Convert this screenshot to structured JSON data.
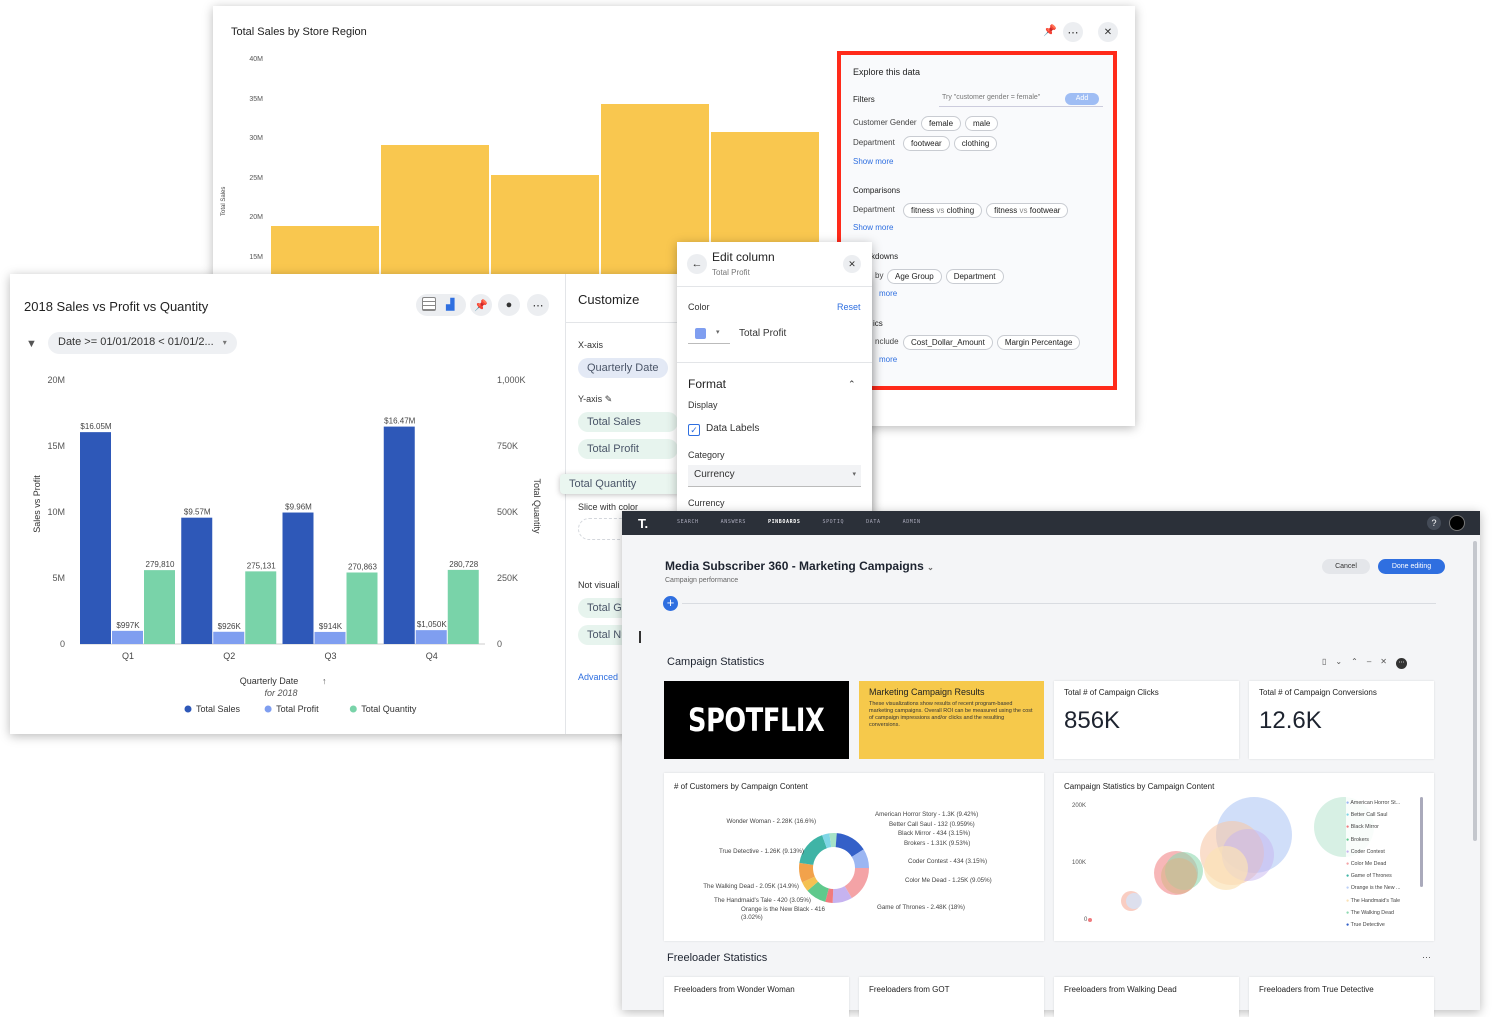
{
  "window_back": {
    "title": "Total Sales by Store Region",
    "y_ticks": [
      "40M",
      "35M",
      "30M",
      "25M",
      "20M",
      "15M"
    ],
    "y_label": "Total Sales",
    "explore": {
      "title": "Explore this data",
      "filters_label": "Filters",
      "filters_placeholder": "Try \"customer gender = female\"",
      "add_label": "Add",
      "gender_label": "Customer Gender",
      "gender_chips": [
        "female",
        "male"
      ],
      "dept_label": "Department",
      "dept_chips": [
        "footwear",
        "clothing"
      ],
      "show_more": "Show more",
      "comparisons_label": "Comparisons",
      "comp_dept_label": "Department",
      "comp_chip_1a": "fitness",
      "comp_chip_1b": "clothing",
      "comp_chip_2a": "fitness",
      "comp_chip_2b": "footwear",
      "vs": "vs",
      "drilldowns_label": "kdowns",
      "drill_by": "by",
      "drill_chips": [
        "Age Group",
        "Department"
      ],
      "more": "more",
      "metrics_label": "ics",
      "include_label": "nclude",
      "metric_chips": [
        "Cost_Dollar_Amount",
        "Margin Percentage"
      ]
    },
    "colors": {
      "bar": "#f9c74f",
      "highlight": "#ff2a1a"
    }
  },
  "window_mid": {
    "title": "2018 Sales vs Profit vs Quantity",
    "filter": "Date >= 01/01/2018 < 01/01/2...",
    "customize": {
      "title": "Customize",
      "x_axis": "X-axis",
      "x_pill": "Quarterly Date",
      "y_axis": "Y-axis",
      "y_pills": [
        "Total Sales",
        "Total Profit"
      ],
      "drag_pill": "Total Quantity",
      "slice": "Slice with color",
      "not_visual": "Not visuali",
      "nv_pills": [
        "Total Gr",
        "Total Nu"
      ],
      "advanced": "Advanced"
    },
    "edit_column": {
      "title": "Edit column",
      "subtitle": "Total Profit",
      "color_label": "Color",
      "reset": "Reset",
      "swatch_label": "Total Profit",
      "format": "Format",
      "display": "Display",
      "data_labels": "Data Labels",
      "category": "Category",
      "category_value": "Currency",
      "currency": "Currency"
    }
  },
  "chart_data": [
    {
      "type": "bar",
      "title": "2018 Sales vs Profit vs Quantity",
      "categories": [
        "Q1",
        "Q2",
        "Q3",
        "Q4"
      ],
      "xlabel": "Quarterly Date",
      "xsub": "for 2018",
      "ylabel": "Sales vs Profit",
      "y2label": "Total Quantity",
      "ylim": [
        0,
        20000000
      ],
      "y2lim": [
        0,
        1000000
      ],
      "y_ticks": [
        "0",
        "5M",
        "10M",
        "15M",
        "20M"
      ],
      "y2_ticks": [
        "0",
        "250K",
        "500K",
        "750K",
        "1,000K"
      ],
      "series": [
        {
          "name": "Total Sales",
          "axis": "left",
          "color": "#2e58b8",
          "values": [
            16050000,
            9570000,
            9960000,
            16470000
          ],
          "labels": [
            "$16.05M",
            "$9.57M",
            "$9.96M",
            "$16.47M"
          ]
        },
        {
          "name": "Total Profit",
          "axis": "left",
          "color": "#7f9ef0",
          "values": [
            997000,
            926000,
            914000,
            1050000
          ],
          "labels": [
            "$997K",
            "$926K",
            "$914K",
            "$1,050K"
          ]
        },
        {
          "name": "Total Quantity",
          "axis": "right",
          "color": "#79d3a9",
          "values": [
            279810,
            275131,
            270863,
            280728
          ],
          "labels": [
            "279,810",
            "275,131",
            "270,863",
            "280,728"
          ]
        }
      ],
      "legend": "bottom"
    }
  ],
  "window_front": {
    "nav": [
      "SEARCH",
      "ANSWERS",
      "PINBOARDS",
      "SPOTIQ",
      "DATA",
      "ADMIN"
    ],
    "help": "?",
    "title": "Media Subscriber 360 - Marketing Campaigns",
    "subtitle": "Campaign performance",
    "cancel": "Cancel",
    "done": "Done editing",
    "section1": "Campaign Statistics",
    "logo": "SPOTFLIX",
    "note_title": "Marketing Campaign Results",
    "note_body": "These visualizations show results of recent program-based marketing campaigns. Overall ROI can be measured using the cost of campaign impressions and/or clicks and the resulting conversions.",
    "kpi1_label": "Total # of Campaign Clicks",
    "kpi1_value": "856K",
    "kpi2_label": "Total # of Campaign Conversions",
    "kpi2_value": "12.6K",
    "donut_title": "# of Customers by Campaign Content",
    "donut_labels": [
      "Wonder Woman - 2.28K (16.6%)",
      "True Detective - 1.26K (9.13%)",
      "The Walking Dead - 2.05K (14.9%)",
      "The Handmaid's Tale - 420 (3.05%)",
      "Orange is the New Black - 416 (3.02%)",
      "American Horror Story - 1.3K (9.42%)",
      "Better Call Saul - 132 (0.959%)",
      "Black Mirror - 434 (3.15%)",
      "Brokers - 1.31K (9.53%)",
      "Coder Contest - 434 (3.15%)",
      "Color Me Dead - 1.25K (9.05%)",
      "Game of Thrones - 2.48K (18%)"
    ],
    "bubble_title": "Campaign Statistics by Campaign Content",
    "bubble_ticks": [
      "200K",
      "100K",
      "0"
    ],
    "legend": [
      "American Horror St...",
      "Better Call Saul",
      "Black Mirror",
      "Brokers",
      "Coder Contest",
      "Color Me Dead",
      "Game of Thrones",
      "Orange is the New ...",
      "The Handmaid's Tale",
      "The Walking Dead",
      "True Detective"
    ],
    "section2": "Freeloader Statistics",
    "free_cards": [
      "Freeloaders from Wonder Woman",
      "Freeloaders from GOT",
      "Freeloaders from Walking Dead",
      "Freeloaders from True Detective"
    ]
  }
}
